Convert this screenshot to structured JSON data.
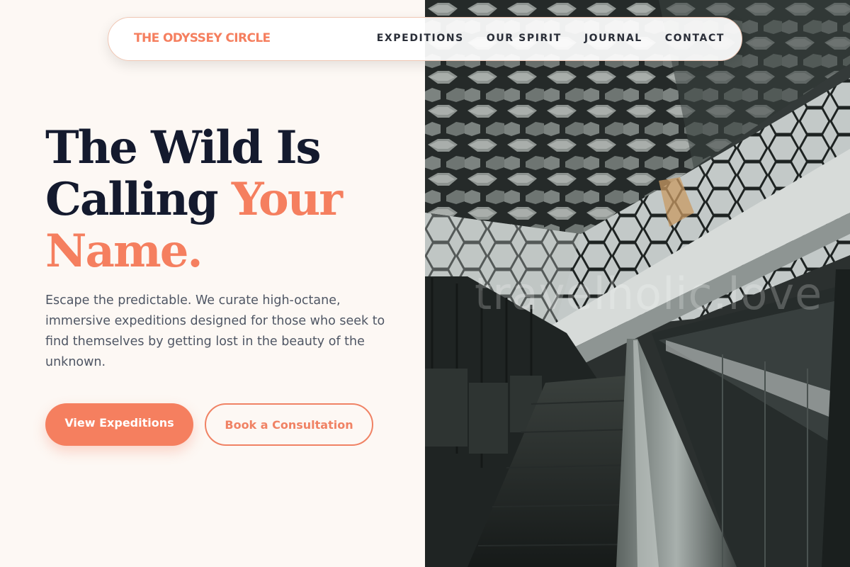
{
  "nav": {
    "brand": "THE ODYSSEY CIRCLE",
    "links": [
      "EXPEDITIONS",
      "OUR SPIRIT",
      "JOURNAL",
      "CONTACT"
    ]
  },
  "hero": {
    "title_line1": "The Wild Is",
    "title_line2_a": "Calling ",
    "title_line2_b": "Your",
    "title_line3": "Name.",
    "description": "Escape the predictable. We curate high-octane, immersive expeditions designed for those who seek to find themselves by getting lost in the beauty of the unknown.",
    "primary_button": "View Expeditions",
    "secondary_button": "Book a Consultation"
  },
  "image": {
    "watermark": "travelholic.love"
  },
  "colors": {
    "accent": "#f57f5f",
    "heading": "#141a2e",
    "background": "#fdf8f4"
  }
}
